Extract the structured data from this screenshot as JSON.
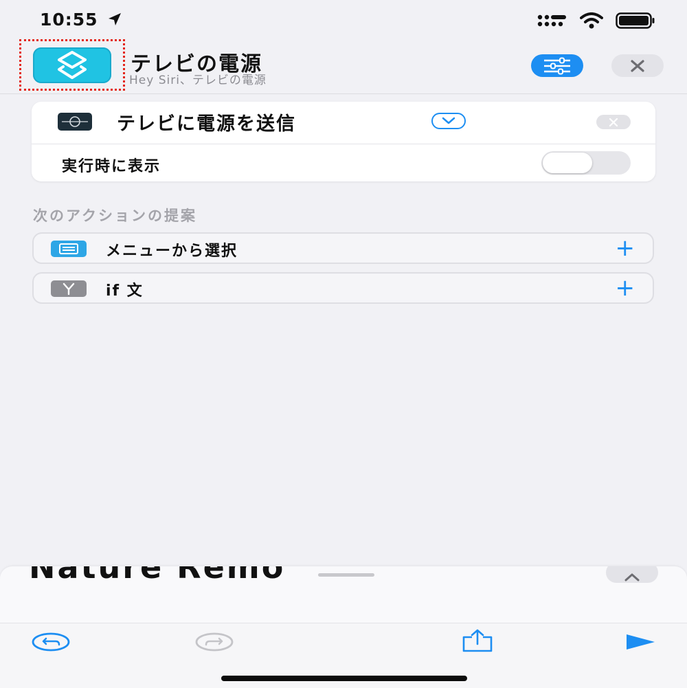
{
  "status_bar": {
    "time": "10:55",
    "icons": [
      "location-arrow-icon",
      "cellular-signal-icon",
      "wifi-icon",
      "battery-icon"
    ]
  },
  "header": {
    "title": "テレビの電源",
    "subtitle": "Hey Siri、テレビの電源",
    "app_icon": "shortcuts-icon",
    "buttons": [
      "settings-sliders-icon",
      "close-icon"
    ]
  },
  "action_card": {
    "title": "テレビに電源を送信",
    "show_when_run_label": "実行時に表示",
    "show_when_run": false
  },
  "suggestions": {
    "title": "次のアクションの提案",
    "items": [
      {
        "label": "メニューから選択",
        "icon": "menu-icon",
        "color": "#2ea6e6"
      },
      {
        "label": "if 文",
        "icon": "if-branch-icon",
        "color": "#8e8e93"
      }
    ]
  },
  "sheet": {
    "heading": "Nature Remo"
  },
  "toolbar": {
    "buttons": [
      "undo-icon",
      "redo-icon",
      "share-icon",
      "run-icon"
    ]
  },
  "colors": {
    "accent": "#1d8ef2",
    "highlight": "#e3261c"
  }
}
